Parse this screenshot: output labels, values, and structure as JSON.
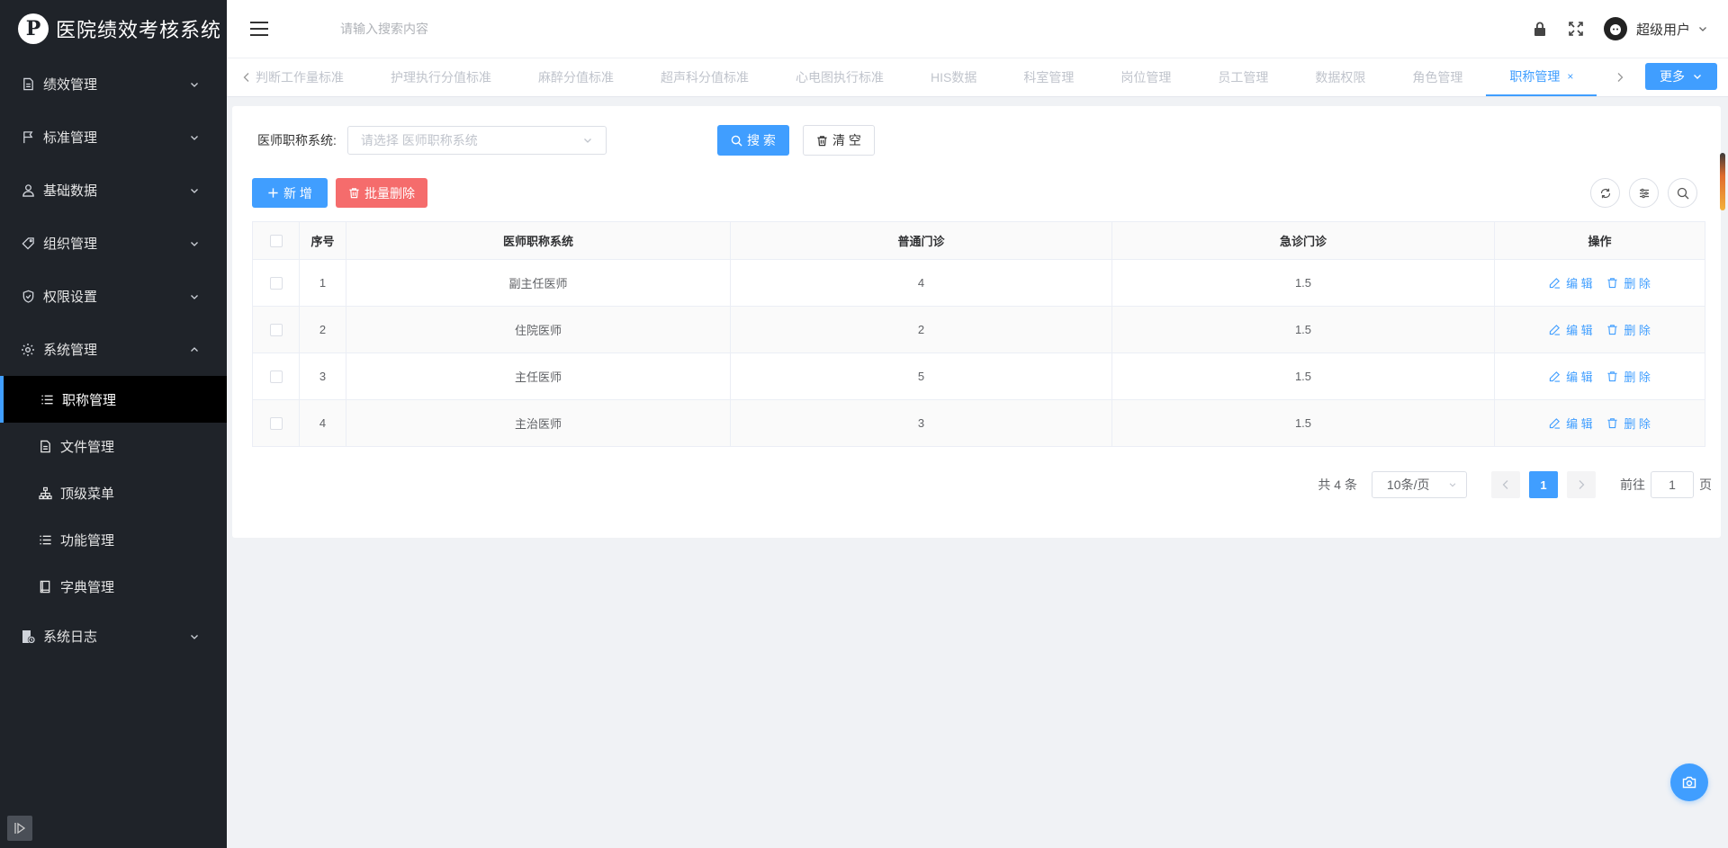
{
  "app": {
    "title": "医院绩效考核系统",
    "logo_icon": "pinterest-logo-icon"
  },
  "sidebar": {
    "menus": [
      {
        "label": "绩效管理",
        "icon": "document-icon",
        "expanded": false
      },
      {
        "label": "标准管理",
        "icon": "flag-icon",
        "expanded": false
      },
      {
        "label": "基础数据",
        "icon": "user-icon",
        "expanded": false
      },
      {
        "label": "组织管理",
        "icon": "tag-icon",
        "expanded": false
      },
      {
        "label": "权限设置",
        "icon": "shield-check-icon",
        "expanded": false
      },
      {
        "label": "系统管理",
        "icon": "gear-icon",
        "expanded": true
      }
    ],
    "submenus": [
      {
        "label": "职称管理",
        "icon": "list-icon",
        "active": true
      },
      {
        "label": "文件管理",
        "icon": "file-icon",
        "active": false
      },
      {
        "label": "顶级菜单",
        "icon": "org-chart-icon",
        "active": false
      },
      {
        "label": "功能管理",
        "icon": "list-icon",
        "active": false
      },
      {
        "label": "字典管理",
        "icon": "book-icon",
        "active": false
      }
    ],
    "last_menu": {
      "label": "系统日志",
      "icon": "log-icon",
      "expanded": false
    }
  },
  "header": {
    "search_placeholder": "请输入搜索内容",
    "user_name": "超级用户"
  },
  "tabs": {
    "items": [
      "判断工作量标准",
      "护理执行分值标准",
      "麻醉分值标准",
      "超声科分值标准",
      "心电图执行标准",
      "HIS数据",
      "科室管理",
      "岗位管理",
      "员工管理",
      "数据权限",
      "角色管理",
      "职称管理"
    ],
    "active_index": 11,
    "close_symbol": "×",
    "more_label": "更多"
  },
  "filter": {
    "label": "医师职称系统:",
    "select_placeholder": "请选择 医师职称系统",
    "search_label": "搜 索",
    "clear_label": "清 空"
  },
  "actions": {
    "add_label": "新 增",
    "batch_delete_label": "批量删除"
  },
  "table": {
    "headers": [
      "序号",
      "医师职称系统",
      "普通门诊",
      "急诊门诊",
      "操作"
    ],
    "rows": [
      {
        "index": "1",
        "title": "副主任医师",
        "outpatient": "4",
        "emergency": "1.5"
      },
      {
        "index": "2",
        "title": "住院医师",
        "outpatient": "2",
        "emergency": "1.5"
      },
      {
        "index": "3",
        "title": "主任医师",
        "outpatient": "5",
        "emergency": "1.5"
      },
      {
        "index": "4",
        "title": "主治医师",
        "outpatient": "3",
        "emergency": "1.5"
      }
    ],
    "edit_label": "编 辑",
    "delete_label": "删 除"
  },
  "pagination": {
    "total_text": "共 4 条",
    "page_size": "10条/页",
    "current_page": "1",
    "goto_label": "前往",
    "goto_value": "1",
    "page_suffix": "页"
  },
  "colors": {
    "primary": "#409eff",
    "danger": "#f56c6c",
    "sidebar_bg": "#1f2329"
  }
}
